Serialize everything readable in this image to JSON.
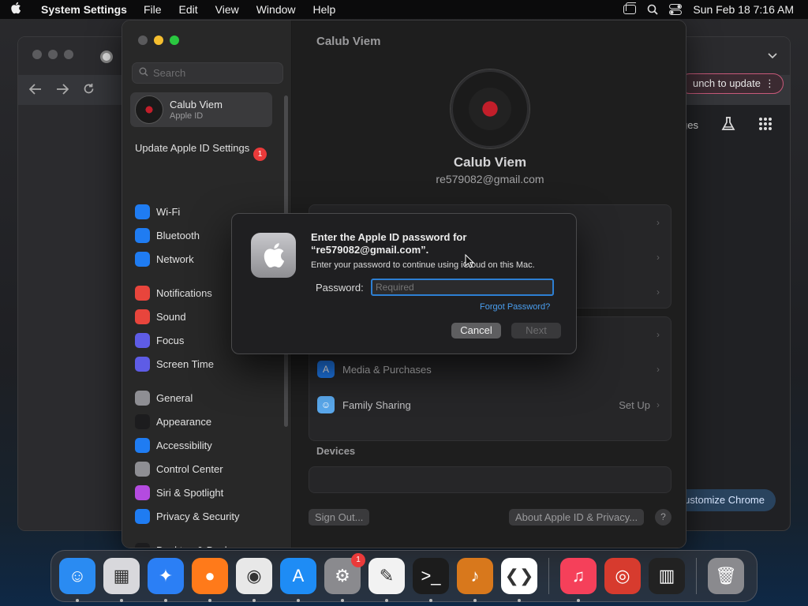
{
  "menubar": {
    "app_name": "System Settings",
    "menus": [
      "File",
      "Edit",
      "View",
      "Window",
      "Help"
    ],
    "datetime": "Sun Feb 18  7:16 AM"
  },
  "chrome": {
    "relaunch_label": "unch to update",
    "toolbar_partial_label": "ges",
    "customize_label": "ustomize Chrome"
  },
  "sidebar": {
    "search_placeholder": "Search",
    "account": {
      "name": "Calub Viem",
      "sub": "Apple ID"
    },
    "update": {
      "label": "Update Apple ID Settings",
      "badge": "1"
    },
    "groups": [
      [
        {
          "label": "Wi-Fi",
          "icon": "wifi-icon",
          "color": "#1f7cf2"
        },
        {
          "label": "Bluetooth",
          "icon": "bluetooth-icon",
          "color": "#1f7cf2"
        },
        {
          "label": "Network",
          "icon": "globe-icon",
          "color": "#1f7cf2"
        }
      ],
      [
        {
          "label": "Notifications",
          "icon": "bell-icon",
          "color": "#e8453c"
        },
        {
          "label": "Sound",
          "icon": "speaker-icon",
          "color": "#e8453c"
        },
        {
          "label": "Focus",
          "icon": "moon-icon",
          "color": "#5e5ce6"
        },
        {
          "label": "Screen Time",
          "icon": "hourglass-icon",
          "color": "#5e5ce6"
        }
      ],
      [
        {
          "label": "General",
          "icon": "gear-icon",
          "color": "#8e8e93"
        },
        {
          "label": "Appearance",
          "icon": "appearance-icon",
          "color": "#1c1c1e"
        },
        {
          "label": "Accessibility",
          "icon": "accessibility-icon",
          "color": "#1f7cf2"
        },
        {
          "label": "Control Center",
          "icon": "control-center-icon",
          "color": "#8e8e93"
        },
        {
          "label": "Siri & Spotlight",
          "icon": "siri-icon",
          "color": "#b44be0"
        },
        {
          "label": "Privacy & Security",
          "icon": "hand-icon",
          "color": "#1f7cf2"
        }
      ],
      [
        {
          "label": "Desktop & Dock",
          "icon": "dock-icon",
          "color": "#1c1c1e"
        }
      ]
    ]
  },
  "main": {
    "title": "Calub Viem",
    "profile_name": "Calub Viem",
    "profile_email": "re579082@gmail.com",
    "rows": [
      {
        "label": "Media & Purchases",
        "value": "",
        "icon": "app-store-icon",
        "color": "#1f7cf2"
      },
      {
        "label": "Family Sharing",
        "value": "Set Up",
        "icon": "family-icon",
        "color": "#5aa8ec"
      }
    ],
    "devices_title": "Devices",
    "sign_out": "Sign Out...",
    "about": "About Apple ID & Privacy...",
    "help": "?"
  },
  "dialog": {
    "title": "Enter the Apple ID password for “re579082@gmail.com”.",
    "message": "Enter your password to continue using iCloud on this Mac.",
    "password_label": "Password:",
    "password_placeholder": "Required",
    "forgot": "Forgot Password?",
    "cancel": "Cancel",
    "next": "Next"
  },
  "dock": {
    "apps": [
      {
        "name": "finder",
        "color": "#2a8bf2",
        "glyph": "☺"
      },
      {
        "name": "launchpad",
        "color": "#d8d8dc",
        "glyph": "▦"
      },
      {
        "name": "safari",
        "color": "#2b7ff5",
        "glyph": "✦"
      },
      {
        "name": "firefox",
        "color": "#ff7a1a",
        "glyph": "●"
      },
      {
        "name": "chrome",
        "color": "#e8e8e8",
        "glyph": "◉"
      },
      {
        "name": "app-store",
        "color": "#1e8cf5",
        "glyph": "A"
      },
      {
        "name": "system-settings",
        "color": "#8a8a8e",
        "glyph": "⚙",
        "badge": "1"
      },
      {
        "name": "textedit",
        "color": "#f2f2f2",
        "glyph": "✎"
      },
      {
        "name": "terminal",
        "color": "#1c1c1c",
        "glyph": ">_"
      },
      {
        "name": "garageband",
        "color": "#d8781c",
        "glyph": "♪"
      },
      {
        "name": "vscode",
        "color": "#ffffff",
        "glyph": "❮❯"
      },
      {
        "name": "music",
        "color": "#f5405a",
        "glyph": "♫"
      },
      {
        "name": "instruments",
        "color": "#d73b2e",
        "glyph": "◎"
      },
      {
        "name": "piano",
        "color": "#222222",
        "glyph": "▥"
      },
      {
        "name": "trash",
        "color": "#8a8a8e",
        "glyph": "🗑"
      }
    ]
  }
}
